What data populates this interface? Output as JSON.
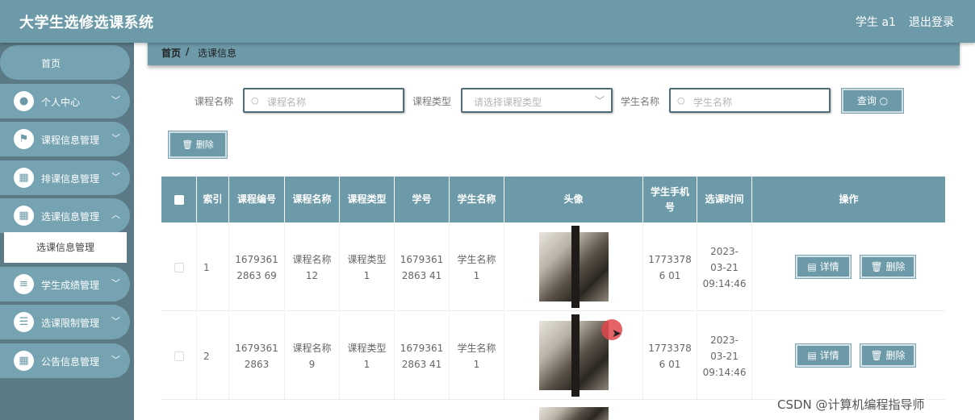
{
  "header": {
    "app_title": "大学生选修选课系统",
    "user": "学生 a1",
    "logout": "退出登录"
  },
  "sidebar": {
    "home": "首页",
    "items": [
      {
        "label": "个人中心",
        "icon": "user-icon",
        "glyph": "●"
      },
      {
        "label": "课程信息管理",
        "icon": "flag-icon",
        "glyph": "⚑"
      },
      {
        "label": "排课信息管理",
        "icon": "grid-icon",
        "glyph": "▦"
      },
      {
        "label": "选课信息管理",
        "icon": "grid-icon",
        "glyph": "▦"
      },
      {
        "label": "学生成绩管理",
        "icon": "list-icon",
        "glyph": "≡"
      },
      {
        "label": "选课限制管理",
        "icon": "sliders-icon",
        "glyph": "☰"
      },
      {
        "label": "公告信息管理",
        "icon": "grid-icon",
        "glyph": "▦"
      }
    ],
    "submenu_active": "选课信息管理"
  },
  "breadcrumb": {
    "home": "首页",
    "separator": "/",
    "current": "选课信息"
  },
  "search": {
    "course_name_label": "课程名称",
    "course_name_placeholder": "课程名称",
    "course_type_label": "课程类型",
    "course_type_placeholder": "请选择课程类型",
    "student_name_label": "学生名称",
    "student_name_placeholder": "学生名称",
    "query_button": "查询"
  },
  "toolbar": {
    "delete_button": "删除"
  },
  "table": {
    "headers": [
      "索引",
      "课程编号",
      "课程名称",
      "课程类型",
      "学号",
      "学生名称",
      "头像",
      "学生手机号",
      "选课时间",
      "操作"
    ],
    "rows": [
      {
        "index": "1",
        "course_no": "1679361 2863 69",
        "course_name": "课程名称12",
        "course_type": "课程类型1",
        "student_no": "1679361 2863 41",
        "student_name": "学生名称1",
        "phone": "1773378 6 01",
        "time": "2023-03-21 09:14:46"
      },
      {
        "index": "2",
        "course_no": "1679361 2863 ",
        "course_name": "课程名称9",
        "course_type": "课程类型1",
        "student_no": "1679361 2863 41",
        "student_name": "学生名称1",
        "phone": "1773378 6 01",
        "time": "2023-03-21 09:14:46"
      }
    ],
    "detail_button": "详情",
    "delete_button": "删除"
  },
  "watermark": "CSDN @计算机编程指导师",
  "colors": {
    "primary": "#6d9aa8",
    "sidebar_bg": "#5b7a86"
  }
}
